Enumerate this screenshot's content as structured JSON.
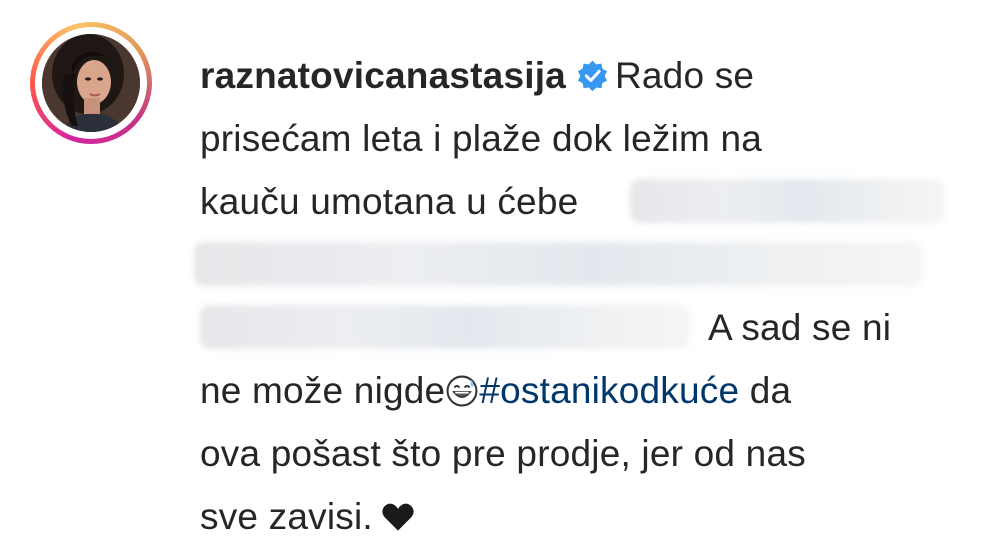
{
  "comment": {
    "username": "raznatovicanastasija",
    "verified_icon": "verified-badge-icon",
    "lines": [
      "Rado se",
      "prisećam leta i plaže dok ležim na",
      "kauču umotana u ćebe",
      "A sad se ni",
      "ne može nigde",
      "da",
      "ova pošast što pre prodje, jer od nas",
      "sve zavisi."
    ],
    "hashtag": "#ostanikodkuće",
    "emoji_icon": "grinning-sweat-emoji-icon",
    "heart_icon": "black-heart-icon"
  },
  "colors": {
    "text": "#262626",
    "hashtag": "#00376b",
    "verified": "#3897f0",
    "ring_start": "#d6249f",
    "ring_end": "#fdc468"
  }
}
